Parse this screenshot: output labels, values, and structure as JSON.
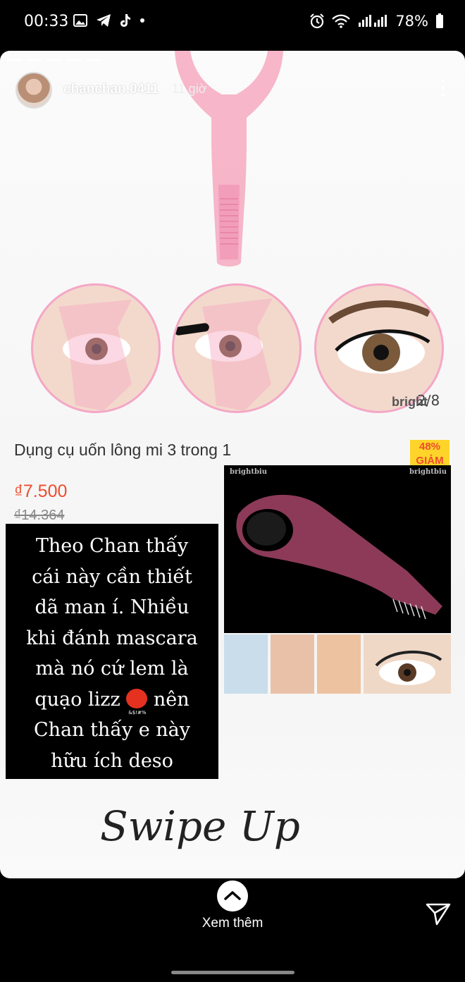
{
  "status_bar": {
    "time": "00:33",
    "battery": "78%",
    "icons": [
      "gallery-icon",
      "telegram-icon",
      "tiktok-icon",
      "dot-icon",
      "alarm-icon",
      "wifi-icon",
      "signal-icon",
      "battery-icon"
    ]
  },
  "story": {
    "username": "chanchan.0411",
    "time_ago": "11 giờ",
    "image_counter": "2/8",
    "watermark": "bright",
    "watermark_tail": "u",
    "product": {
      "title": "Dụng cụ uốn lông mi 3 trong 1",
      "discount": "48%",
      "discount_sub": "GIẢM",
      "price": "₫7.500",
      "old_price": "₫14.364"
    },
    "caption_lines": [
      "Theo Chan thấy",
      "cái này cần thiết",
      "dã man í. Nhiều",
      "khi đánh mascara",
      "mà nó cứ lem là",
      "quạo lizz",
      "nên",
      "Chan thấy e này",
      "hữu ích deso"
    ],
    "product_brand": "brightbiu",
    "swipe_text": "Swipe Up"
  },
  "bottom": {
    "see_more": "Xem thêm"
  },
  "colors": {
    "price": "#ee4d2d",
    "discount_bg": "#ffd42a",
    "tool_pink": "#f6a9c0"
  }
}
